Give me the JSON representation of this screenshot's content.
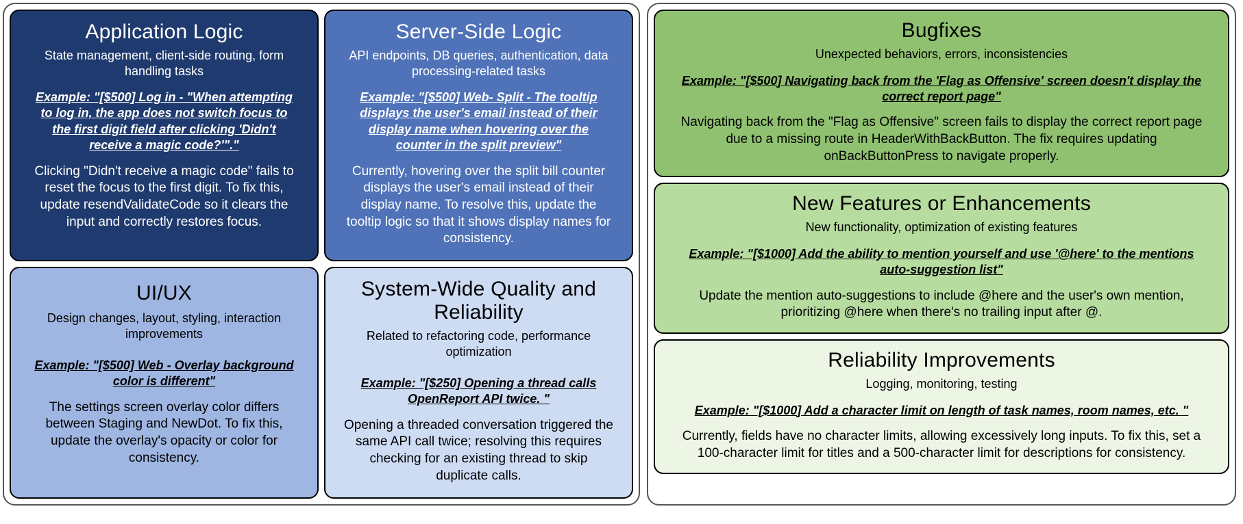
{
  "left": {
    "cards": [
      {
        "title": "Application Logic",
        "sub": "State management, client-side routing, form handling tasks",
        "example": "Example: \"[$500] Log in - \"When attempting to log in, the app does not switch focus to the first digit field after clicking 'Didn't receive a magic code?'\".\"",
        "body": "Clicking \"Didn't receive a magic code\" fails to reset the focus to the first digit. To fix this, update resendValidateCode so it clears the input and correctly restores focus."
      },
      {
        "title": "Server-Side Logic",
        "sub": "API endpoints, DB queries, authentication, data processing-related tasks",
        "example": "Example: \"[$500] Web- Split - The tooltip displays the user's email instead of their display name when hovering over the counter in the split preview\"",
        "body": "Currently, hovering over the split bill counter displays the user's email instead of their display name. To resolve this, update the tooltip logic so that it shows display names for consistency."
      },
      {
        "title": "UI/UX",
        "sub": "Design changes, layout, styling, interaction improvements",
        "example": "Example: \"[$500] Web - Overlay background color is different\"",
        "body": "The settings screen overlay color differs between Staging and NewDot. To fix this, update the overlay's opacity or color for consistency."
      },
      {
        "title": "System-Wide Quality and Reliability",
        "sub": "Related to refactoring code, performance optimization",
        "example": "Example: \"[$250] Opening a thread calls OpenReport API twice. \"",
        "body": "Opening a threaded conversation triggered the same API call twice; resolving this requires checking for an existing thread to skip duplicate calls."
      }
    ]
  },
  "right": {
    "cards": [
      {
        "title": "Bugfixes",
        "sub": "Unexpected behaviors, errors, inconsistencies",
        "example": "Example: \"[$500] Navigating back from the 'Flag as Offensive' screen doesn't display the correct report page\"",
        "body": "Navigating back from the \"Flag as Offensive\" screen fails to display the correct report page due to a missing route in HeaderWithBackButton. The fix requires updating onBackButtonPress to navigate properly."
      },
      {
        "title": "New Features or Enhancements",
        "sub": "New functionality, optimization of existing features",
        "example": "Example: \"[$1000] Add the ability to mention yourself and use '@here' to the mentions auto-suggestion list\"",
        "body": "Update the mention auto-suggestions to include @here and the user's own mention, prioritizing @here when there's no trailing input after @."
      },
      {
        "title": "Reliability Improvements",
        "sub": "Logging, monitoring, testing",
        "example": "Example: \"[$1000] Add a character limit on length of task names, room names, etc. \"",
        "body": "Currently, fields have no character limits, allowing excessively long inputs. To fix this, set a 100-character limit for titles and a 500-character limit for descriptions for consistency."
      }
    ]
  }
}
